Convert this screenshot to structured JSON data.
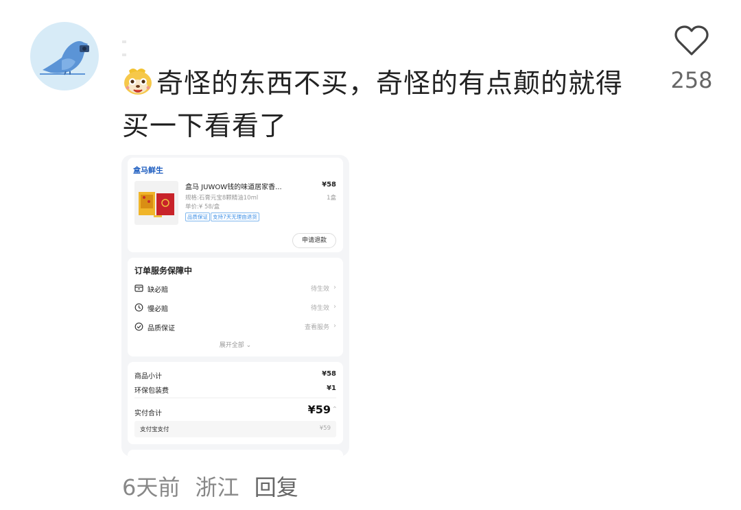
{
  "comment": {
    "text": "奇怪的东西不买，奇怪的有点颠的就得买一下看看了",
    "likes": "258",
    "time": "6天前",
    "location": "浙江",
    "reply_label": "回复"
  },
  "screenshot": {
    "store_name": "盒马鲜生",
    "product": {
      "title": "盒马 JUWOW钱的味道居家香...",
      "price": "¥58",
      "spec": "规格:石膏元宝8颗精油10ml",
      "unit_price": "单价:¥ 58/盒",
      "qty": "1盒",
      "tags": [
        "品质保证",
        "支持7天无理由退货"
      ]
    },
    "refund_button": "申请退款",
    "service": {
      "title": "订单服务保障中",
      "items": [
        {
          "label": "缺必赔",
          "status": "待生效",
          "icon": "box-icon"
        },
        {
          "label": "慢必赔",
          "status": "待生效",
          "icon": "clock-icon"
        },
        {
          "label": "品质保证",
          "status": "查看服务",
          "icon": "check-circle-icon"
        }
      ],
      "expand_label": "展开全部"
    },
    "summary": {
      "subtotal_label": "商品小计",
      "subtotal_value": "¥58",
      "packaging_label": "环保包装费",
      "packaging_value": "¥1",
      "total_label": "实付合计",
      "total_value": "¥59",
      "payment_label": "支付宝支付",
      "payment_value": "¥59"
    }
  },
  "colors": {
    "avatar_bg": "#d7ebf7",
    "bird": "#5b94d6",
    "store_blue": "#1a5bbf",
    "tag_blue": "#3a8ee6"
  }
}
